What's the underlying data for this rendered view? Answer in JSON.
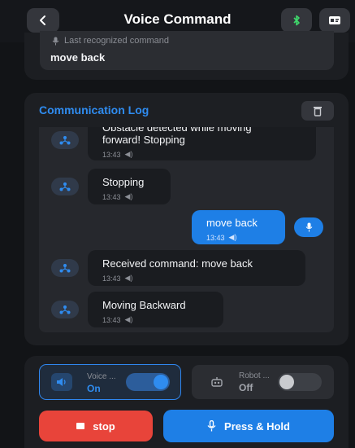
{
  "header": {
    "title": "Voice Command",
    "icons": {
      "back": "chevron-left-icon",
      "bluetooth": "bluetooth-icon",
      "info": "card-icon"
    },
    "bluetooth_color": "#3fd66b"
  },
  "recognition": {
    "label": "Last recognized command",
    "value": "move back"
  },
  "log": {
    "title": "Communication Log",
    "title_color": "#2f8cf0",
    "messages": [
      {
        "sender": "robot",
        "line1": "Obstacle detected while moving",
        "line2": "forward! Stopping",
        "time": "13:43"
      },
      {
        "sender": "robot",
        "text": "Stopping",
        "time": "13:43"
      },
      {
        "sender": "user",
        "text": "move back",
        "time": "13:43"
      },
      {
        "sender": "robot",
        "text": "Received command: move back",
        "time": "13:43"
      },
      {
        "sender": "robot",
        "text": "Moving Backward",
        "time": "13:43"
      }
    ]
  },
  "controls": {
    "voice": {
      "label": "Voice ...",
      "state": "On",
      "enabled": true
    },
    "robot": {
      "label": "Robot ...",
      "state": "Off",
      "enabled": false
    },
    "stop_label": "stop",
    "hold_label": "Press & Hold",
    "stop_color": "#e8443a",
    "accent": "#1e7fe6"
  }
}
